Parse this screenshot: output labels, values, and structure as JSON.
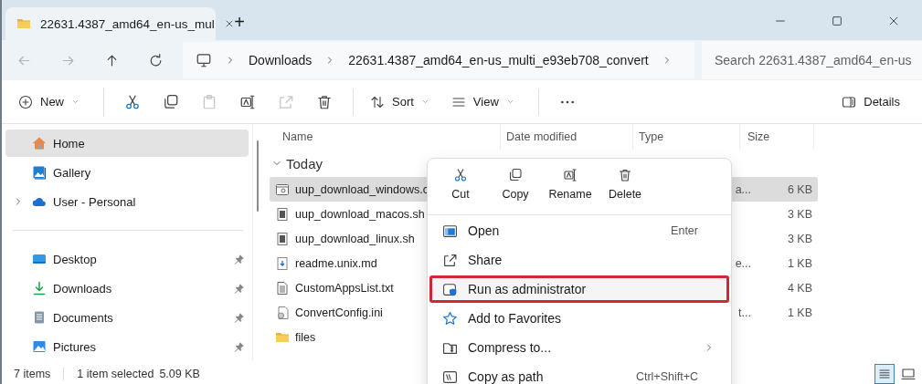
{
  "window": {
    "tab_title": "22631.4387_amd64_en-us_mul",
    "new_tab": "+"
  },
  "address": {
    "breadcrumbs": [
      "Downloads",
      "22631.4387_amd64_en-us_multi_e93eb708_convert"
    ]
  },
  "search": {
    "placeholder": "Search 22631.4387_amd64_en-us"
  },
  "toolbar": {
    "new": "New",
    "sort": "Sort",
    "view": "View",
    "details": "Details",
    "actions": [
      {
        "kind": "cut",
        "disabled": false
      },
      {
        "kind": "copy",
        "disabled": false
      },
      {
        "kind": "paste",
        "disabled": true
      },
      {
        "kind": "rename",
        "disabled": false
      },
      {
        "kind": "share",
        "disabled": true
      },
      {
        "kind": "delete",
        "disabled": false
      }
    ]
  },
  "sidebar": {
    "top": [
      {
        "kind": "home",
        "label": "Home",
        "selected": true,
        "expandable": false
      },
      {
        "kind": "gallery",
        "label": "Gallery",
        "selected": false,
        "expandable": false
      },
      {
        "kind": "cloud",
        "label": "User - Personal",
        "selected": false,
        "expandable": true
      }
    ],
    "quick": [
      {
        "kind": "desktop",
        "label": "Desktop",
        "pinned": true
      },
      {
        "kind": "downloads",
        "label": "Downloads",
        "pinned": true
      },
      {
        "kind": "documents",
        "label": "Documents",
        "pinned": true
      },
      {
        "kind": "pictures",
        "label": "Pictures",
        "pinned": true
      }
    ]
  },
  "file_list": {
    "columns": [
      "Name",
      "Date modified",
      "Type",
      "Size"
    ],
    "group": {
      "label": "Today",
      "expanded": true
    },
    "rows": [
      {
        "kind": "script",
        "name": "uup_download_windows.c",
        "type": "a...",
        "size": "6 KB",
        "selected": true
      },
      {
        "kind": "shell",
        "name": "uup_download_macos.sh",
        "size": "3 KB",
        "selected": false
      },
      {
        "kind": "shell",
        "name": "uup_download_linux.sh",
        "size": "3 KB",
        "selected": false
      },
      {
        "kind": "markdown",
        "name": "readme.unix.md",
        "type": "e...",
        "size": "1 KB",
        "selected": false
      },
      {
        "kind": "text",
        "name": "CustomAppsList.txt",
        "size": "4 KB",
        "selected": false
      },
      {
        "kind": "config",
        "name": "ConvertConfig.ini",
        "type": "t...",
        "size": "1 KB",
        "selected": false
      },
      {
        "kind": "folder",
        "name": "files",
        "selected": false
      }
    ]
  },
  "context_menu": {
    "quick_actions": [
      {
        "kind": "cut",
        "label": "Cut"
      },
      {
        "kind": "copy",
        "label": "Copy"
      },
      {
        "kind": "rename",
        "label": "Rename"
      },
      {
        "kind": "delete",
        "label": "Delete"
      }
    ],
    "items": [
      {
        "kind": "open",
        "label": "Open",
        "shortcut": "Enter",
        "submenu": false,
        "highlighted": false
      },
      {
        "kind": "share",
        "label": "Share",
        "submenu": false,
        "highlighted": false
      },
      {
        "kind": "admin",
        "label": "Run as administrator",
        "submenu": false,
        "highlighted": true
      },
      {
        "kind": "star",
        "label": "Add to Favorites",
        "submenu": false,
        "highlighted": false
      },
      {
        "kind": "zip",
        "label": "Compress to...",
        "submenu": true,
        "highlighted": false
      },
      {
        "kind": "path",
        "label": "Copy as path",
        "shortcut": "Ctrl+Shift+C",
        "submenu": false,
        "highlighted": false
      }
    ]
  },
  "status_bar": {
    "count": "7 items",
    "selection": "1 item selected",
    "size": "5.09 KB",
    "views": [
      {
        "kind": "details",
        "selected": true
      },
      {
        "kind": "tiles",
        "selected": false
      }
    ]
  }
}
